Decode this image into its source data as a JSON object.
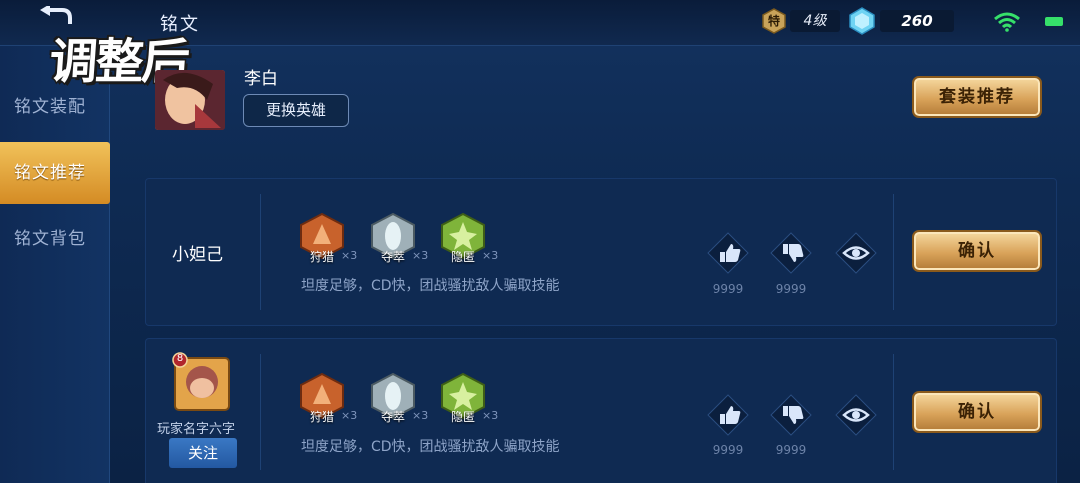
{
  "header": {
    "page_title": "铭文",
    "rank_char": "特",
    "rank_level": "4级",
    "gem_count": "260",
    "overlay_label": "调整后"
  },
  "sidebar": {
    "items": [
      {
        "label": "铭文装配",
        "active": false
      },
      {
        "label": "铭文推荐",
        "active": true
      },
      {
        "label": "铭文背包",
        "active": false
      }
    ]
  },
  "hero": {
    "name": "李白",
    "change_label": "更换英雄",
    "suit_recommend_label": "套装推荐"
  },
  "cards": [
    {
      "author": "小妲己",
      "runes": [
        {
          "name": "狩猎",
          "count": "×3",
          "icon": "hunt-rune-icon",
          "color": "#c8622c"
        },
        {
          "name": "夺萃",
          "count": "×3",
          "icon": "seize-rune-icon",
          "color": "#9fb0b8"
        },
        {
          "name": "隐匿",
          "count": "×3",
          "icon": "stealth-rune-icon",
          "color": "#7fb43a"
        }
      ],
      "description": "坦度足够，CD快，团战骚扰敌人骗取技能",
      "likes": "9999",
      "dislikes": "9999",
      "confirm_label": "确认"
    },
    {
      "author": "玩家名字六字",
      "avatar_level": "8",
      "follow_label": "关注",
      "runes": [
        {
          "name": "狩猎",
          "count": "×3",
          "icon": "hunt-rune-icon",
          "color": "#c8622c"
        },
        {
          "name": "夺萃",
          "count": "×3",
          "icon": "seize-rune-icon",
          "color": "#9fb0b8"
        },
        {
          "name": "隐匿",
          "count": "×3",
          "icon": "stealth-rune-icon",
          "color": "#7fb43a"
        }
      ],
      "description": "坦度足够，CD快，团战骚扰敌人骗取技能",
      "likes": "9999",
      "dislikes": "9999",
      "confirm_label": "确认"
    }
  ]
}
